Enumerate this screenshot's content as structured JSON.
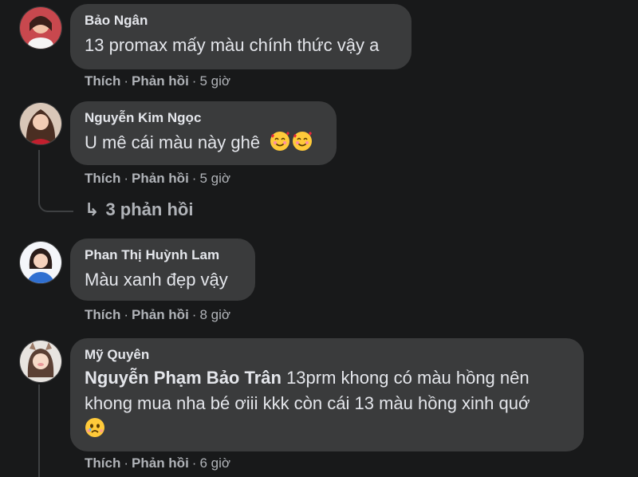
{
  "comments": [
    {
      "author": "Bảo Ngân",
      "text": "13 promax mấy màu chính thức vậy a",
      "like": "Thích",
      "reply": "Phản hồi",
      "time": "5 giờ"
    },
    {
      "author": "Nguyễn Kim Ngọc",
      "text": "U mê cái màu này ghê",
      "emoji": "smiling-face-with-hearts-icon",
      "like": "Thích",
      "reply": "Phản hồi",
      "time": "5 giờ",
      "replies_label": "3 phản hồi"
    },
    {
      "author": "Phan Thị Huỳnh Lam",
      "text": "Màu xanh đẹp vậy",
      "like": "Thích",
      "reply": "Phản hồi",
      "time": "8 giờ"
    },
    {
      "author": "Mỹ Quyên",
      "mention": "Nguyễn Phạm Bảo Trân",
      "text_line1": " 13prm khong có màu hồng nên",
      "text_line2": "khong mua nha bé ơiii kkk còn cái 13 màu hồng xinh quớ",
      "emoji": "face-holding-back-tears-icon",
      "like": "Thích",
      "reply": "Phản hồi",
      "time": "6 giờ"
    }
  ],
  "separator": "·",
  "colors": {
    "background": "#18191a",
    "bubble": "#3a3b3c",
    "text": "#e4e6eb",
    "secondary": "#b0b3b8"
  }
}
